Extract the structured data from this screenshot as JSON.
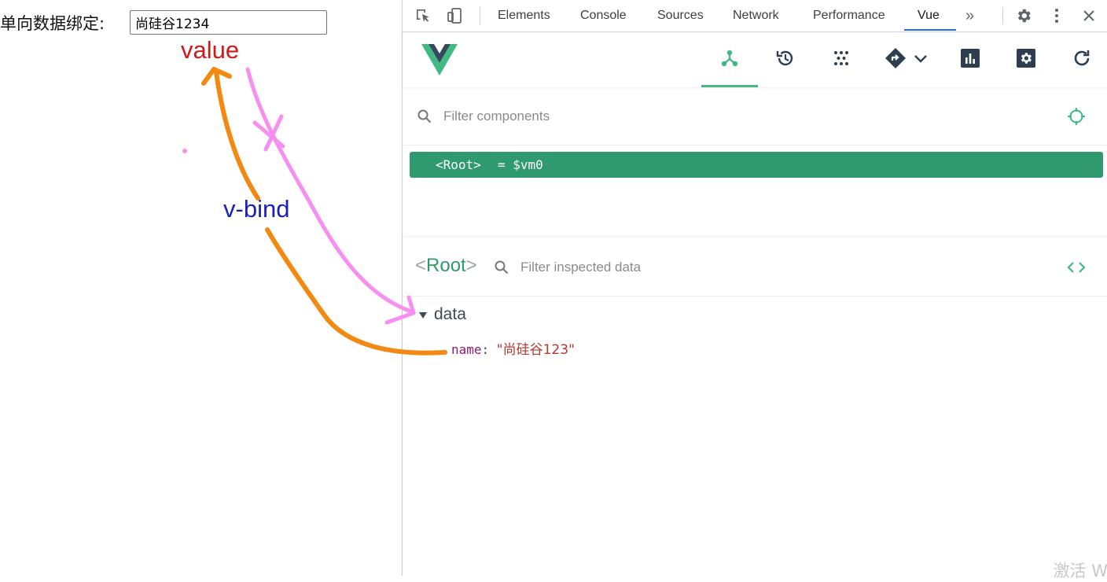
{
  "page": {
    "label": "单向数据绑定:",
    "input_value": "尚硅谷1234",
    "annotation_value": "value",
    "annotation_vbind": "v-bind"
  },
  "devtools": {
    "tabs": [
      {
        "label": "Elements"
      },
      {
        "label": "Console"
      },
      {
        "label": "Sources"
      },
      {
        "label": "Network"
      },
      {
        "label": "Performance"
      },
      {
        "label": "Vue",
        "active": true
      }
    ],
    "more_tabs_label": "»",
    "toolbar_icons": [
      "inspect-element-icon",
      "device-toolbar-icon",
      "settings-icon",
      "kebab-menu-icon",
      "close-icon"
    ]
  },
  "vue": {
    "header_buttons": [
      "components-tree-icon",
      "timeline-icon",
      "vuex-icon",
      "router-icon",
      "performance-icon",
      "settings-icon",
      "refresh-icon"
    ],
    "component_filter_placeholder": "Filter components",
    "tree": {
      "root_label": "<Root>",
      "root_alias": "= $vm0"
    },
    "inspector": {
      "title": "Root",
      "data_filter_placeholder": "Filter inspected data",
      "section": "data",
      "props": [
        {
          "key": "name",
          "value": "\"尚硅谷123\""
        }
      ]
    }
  },
  "watermark": "激活 W",
  "colors": {
    "vue_green": "#42b883",
    "selected_row": "#2f9a6e",
    "tab_underline": "#1a73e8",
    "arrow_orange": "#f28a12",
    "arrow_pink": "#f78ff0",
    "annotation_red": "#d0191a",
    "annotation_blue": "#1a22b4"
  }
}
